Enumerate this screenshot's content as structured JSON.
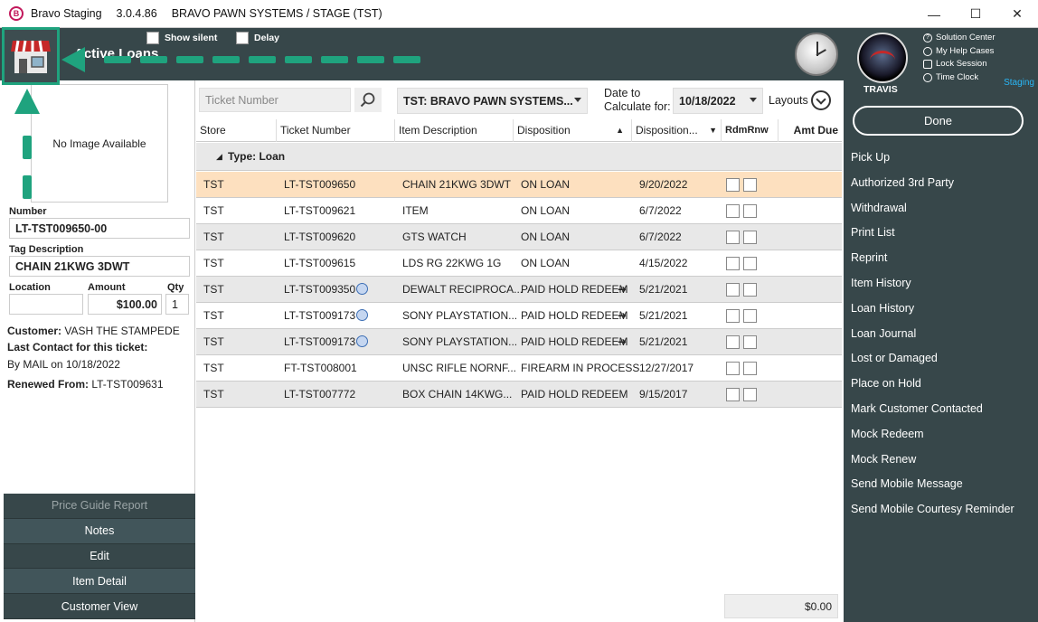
{
  "window": {
    "app_name": "Bravo Staging",
    "version": "3.0.4.86",
    "system": "BRAVO PAWN SYSTEMS / STAGE (TST)",
    "minimize": "—",
    "maximize": "☐",
    "close": "✕"
  },
  "header": {
    "title": "Active Loans",
    "show_silent_label": "Show silent",
    "delay_label": "Delay"
  },
  "user": {
    "name": "TRAVIS",
    "links": [
      "Solution Center",
      "My Help Cases",
      "Lock Session",
      "Time Clock"
    ],
    "env": "Staging",
    "done_label": "Done"
  },
  "actions": [
    "Pick Up",
    "Authorized 3rd Party",
    "Withdrawal",
    "Print List",
    "Reprint",
    "Item History",
    "Loan History",
    "Loan Journal",
    "Lost or Damaged",
    "Place on Hold",
    "Mark Customer Contacted",
    "Mock Redeem",
    "Mock Renew",
    "Send Mobile Message",
    "Send Mobile Courtesy Reminder"
  ],
  "detail": {
    "no_image": "No Image Available",
    "number_label": "Number",
    "number": "LT-TST009650-00",
    "tag_label": "Tag Description",
    "tag": "CHAIN 21KWG 3DWT",
    "location_label": "Location",
    "location": "",
    "amount_label": "Amount",
    "amount": "$100.00",
    "qty_label": "Qty",
    "qty": "1",
    "customer_label": "Customer:",
    "customer": "VASH THE STAMPEDE",
    "last_contact_label": "Last Contact for this ticket:",
    "last_contact": "By MAIL on 10/18/2022",
    "renewed_label": "Renewed From:",
    "renewed": "LT-TST009631"
  },
  "left_buttons": [
    "Price Guide Report",
    "Notes",
    "Edit",
    "Item Detail",
    "Customer View"
  ],
  "filters": {
    "ticket_placeholder": "Ticket Number",
    "store": "TST: BRAVO PAWN SYSTEMS...",
    "date_label_1": "Date to",
    "date_label_2": "Calculate for:",
    "date": "10/18/2022",
    "layouts": "Layouts"
  },
  "grid": {
    "columns": [
      "Store",
      "Ticket Number",
      "Item Description",
      "Disposition",
      "Disposition...",
      "RdmRnw",
      "Amt Due"
    ],
    "group": "Type: Loan",
    "rows": [
      {
        "store": "TST",
        "ticket": "LT-TST009650",
        "desc": "CHAIN 21KWG 3DWT",
        "disp": "ON LOAN",
        "date": "9/20/2022",
        "renew": false,
        "arrow": false
      },
      {
        "store": "TST",
        "ticket": "LT-TST009621",
        "desc": "ITEM",
        "disp": "ON LOAN",
        "date": "6/7/2022",
        "renew": false,
        "arrow": false
      },
      {
        "store": "TST",
        "ticket": "LT-TST009620",
        "desc": "GTS WATCH",
        "disp": "ON LOAN",
        "date": "6/7/2022",
        "renew": false,
        "arrow": false
      },
      {
        "store": "TST",
        "ticket": "LT-TST009615",
        "desc": "LDS RG 22KWG 1G",
        "disp": "ON LOAN",
        "date": "4/15/2022",
        "renew": false,
        "arrow": false
      },
      {
        "store": "TST",
        "ticket": "LT-TST009350",
        "desc": "DEWALT RECIPROCA...",
        "disp": "PAID HOLD REDEEM",
        "date": "5/21/2021",
        "renew": true,
        "arrow": true
      },
      {
        "store": "TST",
        "ticket": "LT-TST009173",
        "desc": "SONY PLAYSTATION...",
        "disp": "PAID HOLD REDEEM",
        "date": "5/21/2021",
        "renew": true,
        "arrow": true
      },
      {
        "store": "TST",
        "ticket": "LT-TST009173",
        "desc": "SONY PLAYSTATION...",
        "disp": "PAID HOLD REDEEM",
        "date": "5/21/2021",
        "renew": true,
        "arrow": true
      },
      {
        "store": "TST",
        "ticket": "FT-TST008001",
        "desc": "UNSC RIFLE NORNF...",
        "disp": "FIREARM IN PROCESS",
        "date": "12/27/2017",
        "renew": false,
        "arrow": false
      },
      {
        "store": "TST",
        "ticket": "LT-TST007772",
        "desc": "BOX CHAIN 14KWG...",
        "disp": "PAID HOLD REDEEM",
        "date": "9/15/2017",
        "renew": false,
        "arrow": false
      }
    ],
    "total": "$0.00"
  }
}
